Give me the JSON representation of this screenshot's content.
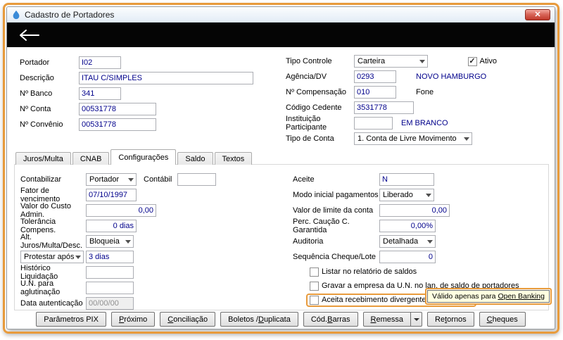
{
  "colors": {
    "annotation_orange": "#E89B3C",
    "value_navy": "#00008B",
    "tooltip_bg": "#FFFFE1"
  },
  "window": {
    "title": "Cadastro de Portadores",
    "close_glyph": "✕"
  },
  "form": {
    "portador": {
      "label": "Portador",
      "value": "I02"
    },
    "descricao": {
      "label": "Descrição",
      "value": "ITAU C/SIMPLES"
    },
    "n_banco": {
      "label": "Nº Banco",
      "value": "341"
    },
    "n_conta": {
      "label": "Nº Conta",
      "value": "00531778"
    },
    "n_convenio": {
      "label": "Nº Convênio",
      "value": "00531778"
    },
    "tipo_controle": {
      "label": "Tipo Controle",
      "value": "Carteira"
    },
    "ativo": {
      "label": "Ativo",
      "checked": true
    },
    "agencia_dv": {
      "label": "Agência/DV",
      "value": "0293",
      "note": "NOVO HAMBURGO"
    },
    "n_compensacao": {
      "label": "Nº Compensação",
      "value": "010",
      "note": "Fone"
    },
    "codigo_cedente": {
      "label": "Código Cedente",
      "value": "3531778"
    },
    "instituicao_participante": {
      "label": "Instituição Participante",
      "value": "",
      "note": "EM BRANCO"
    },
    "tipo_de_conta": {
      "label": "Tipo de Conta",
      "value": "1. Conta de Livre Movimento"
    }
  },
  "tabs": {
    "items": [
      "Juros/Multa",
      "CNAB",
      "Configurações",
      "Saldo",
      "Textos"
    ],
    "active": "Configurações"
  },
  "config": {
    "contabilizar": {
      "label": "Contabilizar",
      "value": "Portador"
    },
    "contabil": {
      "label": "Contábil",
      "value": ""
    },
    "fator_vencimento": {
      "label": "Fator de vencimento",
      "value": "07/10/1997"
    },
    "custo_admin": {
      "label": "Valor do Custo Admin.",
      "value": "0,00"
    },
    "tolerancia": {
      "label": "Tolerância Compens.",
      "value": "0 dias"
    },
    "alt_juros": {
      "label": "Alt. Juros/Multa/Desc.",
      "value": "Bloqueia"
    },
    "protestar": {
      "label": "Protestar após",
      "value": "3 dias"
    },
    "historico_liquidacao": {
      "label": "Histórico Liquidação",
      "value": ""
    },
    "un_aglutinacao": {
      "label": "U.N. para aglutinação",
      "value": ""
    },
    "data_autenticacao": {
      "label": "Data autenticação",
      "value": "00/00/00"
    },
    "aceite": {
      "label": "Aceite",
      "value": "N"
    },
    "modo_inicial": {
      "label": "Modo inicial pagamentos",
      "value": "Liberado"
    },
    "limite_conta": {
      "label": "Valor de limite da conta",
      "value": "0,00"
    },
    "caucao": {
      "label": "Perc. Caução C. Garantida",
      "value": "0,00%"
    },
    "auditoria": {
      "label": "Auditoria",
      "value": "Detalhada"
    },
    "sequencia": {
      "label": "Sequência Cheque/Lote",
      "value": "0"
    },
    "chk_listar": {
      "label": "Listar no relatório de saldos",
      "checked": false
    },
    "chk_gravar": {
      "label": "Gravar a empresa da U.N. no lan. de saldo de portadores",
      "checked": false
    },
    "chk_aceita": {
      "label": "Aceita recebimento divergente da cobrança",
      "checked": false
    }
  },
  "tooltip": {
    "prefix": "Válido apenas para ",
    "highlighted_term": "Open Banking"
  },
  "buttons": [
    {
      "pre": "Parâmetros PIX",
      "accel": "",
      "post": ""
    },
    {
      "pre": "",
      "accel": "P",
      "post": "róximo"
    },
    {
      "pre": "",
      "accel": "C",
      "post": "onciliação"
    },
    {
      "pre": "Boletos / ",
      "accel": "D",
      "post": "uplicata"
    },
    {
      "pre": "Cód. ",
      "accel": "B",
      "post": "arras"
    },
    {
      "pre": "",
      "accel": "R",
      "post": "emessa"
    },
    {
      "pre": "Re",
      "accel": "t",
      "post": "ornos"
    },
    {
      "pre": "",
      "accel": "C",
      "post": "heques"
    }
  ]
}
